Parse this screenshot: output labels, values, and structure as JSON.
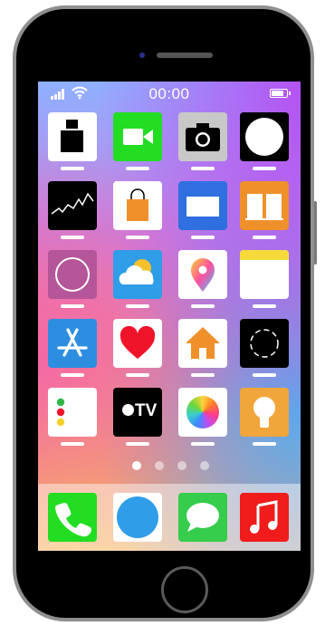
{
  "status_bar": {
    "time": "00:00"
  },
  "home_grid": {
    "apps": [
      {
        "name": "clock-app-icon"
      },
      {
        "name": "facetime-app-icon"
      },
      {
        "name": "camera-app-icon"
      },
      {
        "name": "circle-app-icon"
      },
      {
        "name": "stocks-app-icon"
      },
      {
        "name": "store-bag-app-icon"
      },
      {
        "name": "mail-app-icon"
      },
      {
        "name": "books-app-icon"
      },
      {
        "name": "circle-outline-app-icon"
      },
      {
        "name": "weather-app-icon"
      },
      {
        "name": "maps-app-icon"
      },
      {
        "name": "notes-app-icon"
      },
      {
        "name": "app-store-app-icon"
      },
      {
        "name": "health-app-icon"
      },
      {
        "name": "home-app-icon"
      },
      {
        "name": "dashed-circle-app-icon"
      },
      {
        "name": "reminders-app-icon"
      },
      {
        "name": "apple-tv-app-icon"
      },
      {
        "name": "photos-app-icon"
      },
      {
        "name": "tips-app-icon"
      }
    ],
    "tv_label": "TV"
  },
  "page_indicator": {
    "pages": 4,
    "current": 1
  },
  "dock": {
    "apps": [
      {
        "name": "phone-app-icon"
      },
      {
        "name": "safari-circle-app-icon"
      },
      {
        "name": "messages-app-icon"
      },
      {
        "name": "music-app-icon"
      }
    ]
  },
  "colors": {
    "facetime": "#22dd22",
    "camera": "#c8c8c8",
    "stocks": "#000000",
    "store": "#ffffff",
    "mail": "#2f6fe0",
    "books": "#f0902a",
    "weather": "#2f9de8",
    "appstore": "#2d8ee0",
    "health": "#ffffff",
    "home": "#ffffff",
    "tips": "#f0a63a",
    "phone": "#22dd22",
    "safari": "#2f9de8",
    "messages": "#36cc4c",
    "music": "#f01b1b"
  }
}
